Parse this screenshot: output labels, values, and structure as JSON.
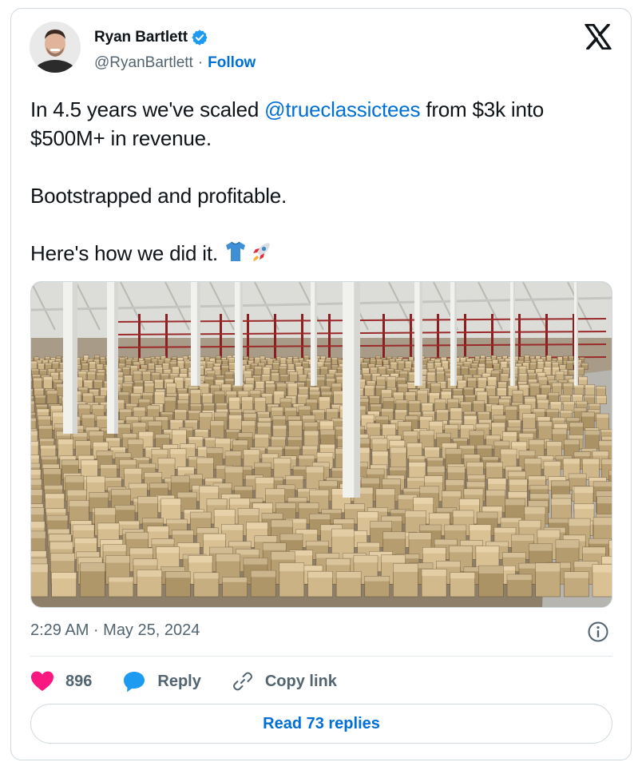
{
  "author": {
    "name": "Ryan Bartlett",
    "handle": "@RyanBartlett",
    "separator": "·",
    "follow_label": "Follow",
    "verified": true
  },
  "brand_icon": "x-logo-icon",
  "tweet": {
    "line1_pre": "In 4.5 years we've scaled ",
    "mention": "@trueclassictees",
    "line1_post": " from $3k into $500M+ in revenue.",
    "line2": "Bootstrapped and profitable.",
    "line3": "Here's how we did it. ",
    "emojis": [
      "t-shirt-icon",
      "rocket-icon"
    ]
  },
  "media": {
    "icon": "warehouse-photo"
  },
  "timestamp": "2:29 AM · May 25, 2024",
  "actions": {
    "like_count": "896",
    "reply_label": "Reply",
    "copy_label": "Copy link"
  },
  "read_replies_label": "Read 73 replies",
  "colors": {
    "accent": "#006fd6",
    "like": "#f91880",
    "reply_icon": "#1d9bf0",
    "secondary_text": "#536471",
    "border": "#cfd9de"
  }
}
